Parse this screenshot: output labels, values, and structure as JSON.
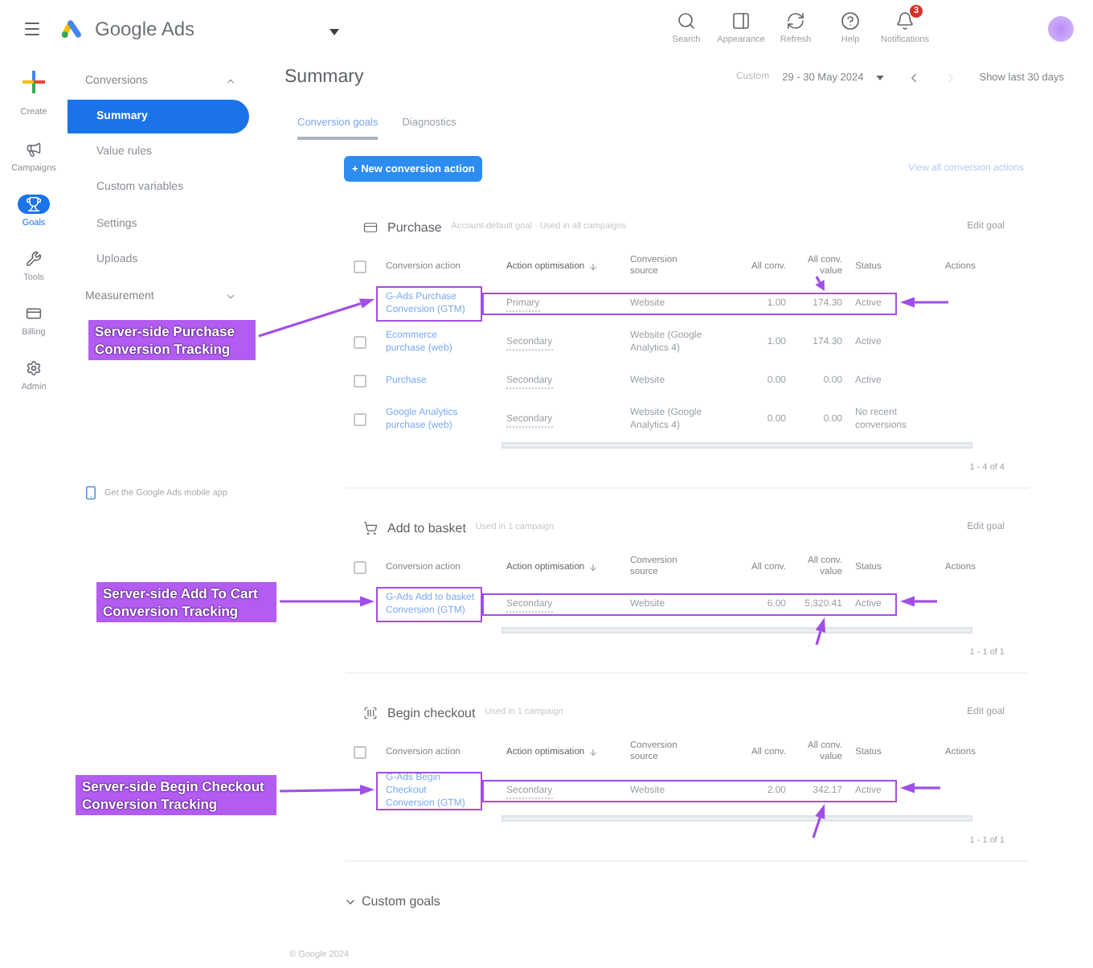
{
  "top_bar": {
    "product": "Google Ads",
    "actions": [
      {
        "label": "Search"
      },
      {
        "label": "Appearance"
      },
      {
        "label": "Refresh"
      },
      {
        "label": "Help"
      },
      {
        "label": "Notifications",
        "badge": "3"
      }
    ]
  },
  "nav_rail": [
    {
      "label": "Create",
      "selected": false
    },
    {
      "label": "Campaigns",
      "selected": false
    },
    {
      "label": "Goals",
      "selected": true
    },
    {
      "label": "Tools",
      "selected": false
    },
    {
      "label": "Billing",
      "selected": false
    },
    {
      "label": "Admin",
      "selected": false
    }
  ],
  "sidebar": {
    "groups": [
      {
        "label": "Conversions",
        "expanded": true,
        "items": [
          {
            "label": "Summary",
            "selected": true
          },
          {
            "label": "Value rules",
            "selected": false
          },
          {
            "label": "Custom variables",
            "selected": false
          },
          {
            "label": "Settings",
            "selected": false
          },
          {
            "label": "Uploads",
            "selected": false
          }
        ]
      },
      {
        "label": "Measurement",
        "expanded": false
      }
    ],
    "app_link": "Get the Google Ads mobile app"
  },
  "header": {
    "title": "Summary",
    "date_label": "Custom",
    "date_range": "29 - 30 May 2024",
    "next_disabled": true,
    "quick_range": "Show last 30 days"
  },
  "tabs": [
    {
      "label": "Conversion goals",
      "selected": true
    },
    {
      "label": "Diagnostics",
      "selected": false
    }
  ],
  "toolbar": {
    "new_button": "+ New conversion action",
    "view_all": "View all conversion actions"
  },
  "goals": [
    {
      "title": "Purchase",
      "subtitle": "Account-default goal · Used in all campaigns",
      "edit": "Edit goal",
      "header_checked": false,
      "columns": [
        {
          "label": "Conversion action",
          "sorted": false
        },
        {
          "label": "Action optimisation",
          "sorted": true
        },
        {
          "label": "Conversion source",
          "sorted": false
        },
        {
          "label": "All conv.",
          "sorted": false
        },
        {
          "label": "All conv. value",
          "sorted": false
        },
        {
          "label": "Status",
          "sorted": false
        },
        {
          "label": "Actions",
          "sorted": false
        }
      ],
      "rows": [
        {
          "action": "G-Ads Purchase Conversion (GTM)",
          "optimisation": "Primary",
          "source": "Website",
          "all_conv": "1.00",
          "all_conv_value": "174.30",
          "status": "Active",
          "annotation": "Server-side Purchase Conversion Tracking"
        },
        {
          "checked": false,
          "action": "Ecommerce purchase (web)",
          "optimisation": "Secondary",
          "source": "Website (Google Analytics 4)",
          "all_conv": "1.00",
          "all_conv_value": "174.30",
          "status": "Active"
        },
        {
          "checked": false,
          "action": "Purchase",
          "optimisation": "Secondary",
          "source": "Website",
          "all_conv": "0.00",
          "all_conv_value": "0.00",
          "status": "Active"
        },
        {
          "checked": false,
          "action": "Google Analytics purchase (web)",
          "optimisation": "Secondary",
          "source": "Website (Google Analytics 4)",
          "all_conv": "0.00",
          "all_conv_value": "0.00",
          "status": "No recent conversions"
        }
      ],
      "pager": "1 - 4 of 4"
    },
    {
      "title": "Add to basket",
      "subtitle": "Used in 1 campaign",
      "edit": "Edit goal",
      "header_checked": false,
      "columns": [
        {
          "label": "Conversion action",
          "sorted": false
        },
        {
          "label": "Action optimisation",
          "sorted": true
        },
        {
          "label": "Conversion source",
          "sorted": false
        },
        {
          "label": "All conv.",
          "sorted": false
        },
        {
          "label": "All conv. value",
          "sorted": false
        },
        {
          "label": "Status",
          "sorted": false
        },
        {
          "label": "Actions",
          "sorted": false
        }
      ],
      "rows": [
        {
          "action": "G-Ads Add to basket Conversion (GTM)",
          "optimisation": "Secondary",
          "source": "Website",
          "all_conv": "6.00",
          "all_conv_value": "5,320.41",
          "status": "Active",
          "annotation": "Server-side Add To Cart Conversion Tracking"
        }
      ],
      "pager": "1 - 1 of 1"
    },
    {
      "title": "Begin checkout",
      "subtitle": "Used in 1 campaign",
      "edit": "Edit goal",
      "header_checked": false,
      "columns": [
        {
          "label": "Conversion action",
          "sorted": false
        },
        {
          "label": "Action optimisation",
          "sorted": true
        },
        {
          "label": "Conversion source",
          "sorted": false
        },
        {
          "label": "All conv.",
          "sorted": false
        },
        {
          "label": "All conv. value",
          "sorted": false
        },
        {
          "label": "Status",
          "sorted": false
        },
        {
          "label": "Actions",
          "sorted": false
        }
      ],
      "rows": [
        {
          "action": "G-Ads Begin Checkout Conversion (GTM)",
          "optimisation": "Secondary",
          "source": "Website",
          "all_conv": "2.00",
          "all_conv_value": "342.17",
          "status": "Active",
          "annotation": "Server-side Begin Checkout Conversion Tracking"
        }
      ],
      "pager": "1 - 1 of 1"
    }
  ],
  "custom_goals": {
    "label": "Custom goals",
    "expanded": false
  },
  "footer": "© Google 2024"
}
